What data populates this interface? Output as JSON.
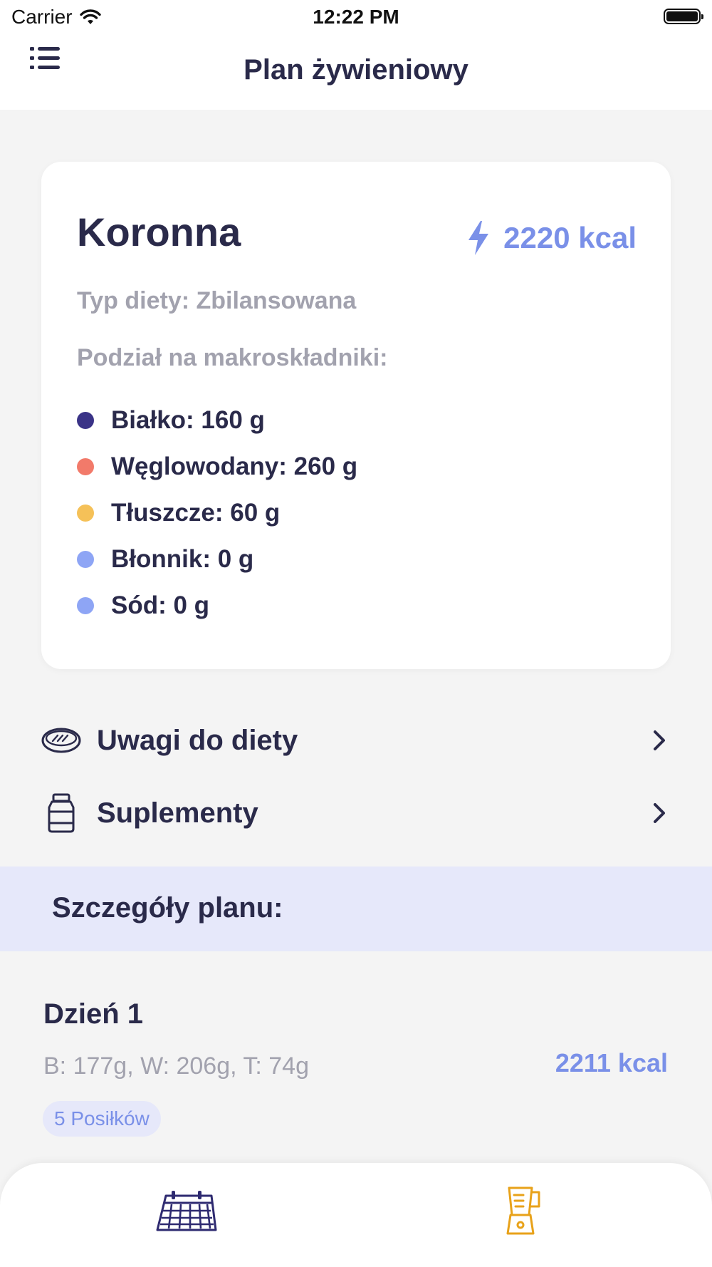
{
  "status_bar": {
    "carrier": "Carrier",
    "time": "12:22 PM"
  },
  "nav": {
    "title": "Plan żywieniowy",
    "menu_icon": "list-icon"
  },
  "summary": {
    "name": "Koronna",
    "kcal": "2220 kcal",
    "kcal_icon": "lightning-icon",
    "diet_type": "Typ diety: Zbilansowana",
    "macro_title": "Podział na makroskładniki:",
    "macros": [
      {
        "label": "Białko: 160 g",
        "color": "#3A3387"
      },
      {
        "label": "Węglowodany: 260 g",
        "color": "#F27A6A"
      },
      {
        "label": "Tłuszcze: 60 g",
        "color": "#F5C158"
      },
      {
        "label": "Błonnik: 0 g",
        "color": "#8EA5F5"
      },
      {
        "label": "Sód: 0 g",
        "color": "#8EA5F5"
      }
    ]
  },
  "rows": [
    {
      "label": "Uwagi do diety",
      "icon": "steak-icon"
    },
    {
      "label": "Suplementy",
      "icon": "supplement-jar-icon"
    }
  ],
  "section": {
    "title": "Szczegóły planu:"
  },
  "days": [
    {
      "title": "Dzień 1",
      "macros": "B: 177g, W: 206g, T: 74g",
      "kcal": "2211 kcal",
      "meals": "5 Posiłków"
    }
  ],
  "tab_bar": {
    "tabs": [
      {
        "icon": "calendar-icon",
        "active": true
      },
      {
        "icon": "blender-icon",
        "active": false
      }
    ]
  },
  "colors": {
    "accent": "#7A90E8",
    "text_dark": "#2A2A4A",
    "text_muted": "#A2A2AE",
    "section_bg": "#E6E8FA",
    "page_bg": "#F4F4F4",
    "tab_orange": "#E8A21A"
  }
}
